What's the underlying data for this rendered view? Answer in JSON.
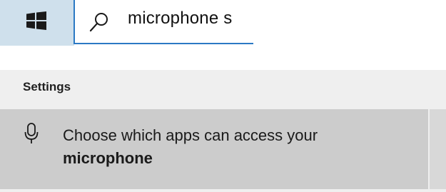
{
  "taskbar": {
    "start_icon": "windows-logo-icon",
    "search": {
      "icon": "search-icon",
      "value": "microphone s"
    }
  },
  "results": {
    "group_label": "Settings",
    "items": [
      {
        "icon": "microphone-icon",
        "text": "Choose which apps can access your",
        "bold_text": "microphone"
      }
    ]
  },
  "colors": {
    "start_bg": "#cfe0ec",
    "search_border": "#2b79c4",
    "panel_bg": "#efefef",
    "result_selected_bg": "#cccccc"
  }
}
